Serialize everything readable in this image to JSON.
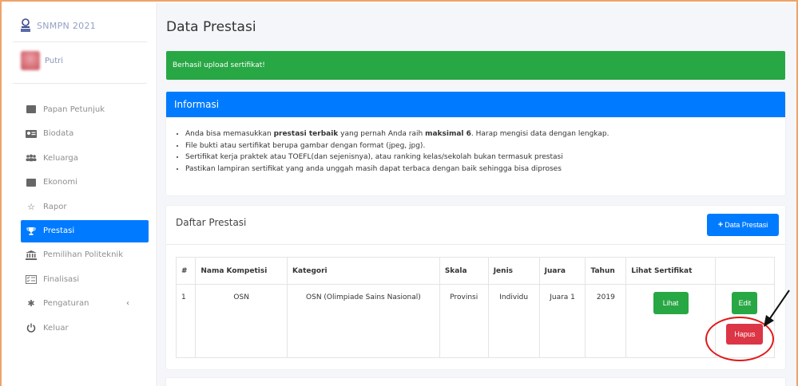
{
  "brand": {
    "title": "SNMPN 2021"
  },
  "user": {
    "name": "Putri"
  },
  "sidebar": {
    "items": [
      {
        "label": "Papan Petunjuk",
        "icon": "dashboard-icon"
      },
      {
        "label": "Biodata",
        "icon": "id-card-icon"
      },
      {
        "label": "Keluarga",
        "icon": "users-icon"
      },
      {
        "label": "Ekonomi",
        "icon": "wallet-icon"
      },
      {
        "label": "Rapor",
        "icon": "star-icon"
      },
      {
        "label": "Prestasi",
        "icon": "trophy-icon",
        "active": true
      },
      {
        "label": "Pemilihan Politeknik",
        "icon": "university-icon"
      },
      {
        "label": "Finalisasi",
        "icon": "checklist-icon"
      },
      {
        "label": "Pengaturan",
        "icon": "gear-icon",
        "chevron": "‹"
      },
      {
        "label": "Keluar",
        "icon": "power-icon"
      }
    ]
  },
  "page": {
    "title": "Data Prestasi"
  },
  "alert": {
    "message": "Berhasil upload sertifikat!"
  },
  "info": {
    "title": "Informasi",
    "items": {
      "i1_a": "Anda bisa memasukkan ",
      "i1_b": "prestasi terbaik",
      "i1_c": " yang pernah Anda raih ",
      "i1_d": "maksimal 6",
      "i1_e": ". Harap mengisi data dengan lengkap.",
      "i2": "File bukti atau sertifikat berupa gambar dengan format (jpeg, jpg).",
      "i3": "Sertifikat kerja praktek atau TOEFL(dan sejenisnya), atau ranking kelas/sekolah bukan termasuk prestasi",
      "i4": "Pastikan lampiran sertifikat yang anda unggah masih dapat terbaca dengan baik sehingga bisa diproses"
    }
  },
  "prestasi": {
    "title": "Daftar Prestasi",
    "add_label": "Data Prestasi",
    "columns": [
      "#",
      "Nama Kompetisi",
      "Kategori",
      "Skala",
      "Jenis",
      "Juara",
      "Tahun",
      "Lihat Sertifikat",
      ""
    ],
    "rows": [
      {
        "no": "1",
        "nama": "OSN",
        "kategori": "OSN (Olimpiade Sains Nasional)",
        "skala": "Provinsi",
        "jenis": "Individu",
        "juara": "Juara 1",
        "tahun": "2019",
        "lihat_label": "Lihat",
        "edit_label": "Edit",
        "hapus_label": "Hapus"
      }
    ]
  },
  "colors": {
    "primary": "#007bff",
    "success": "#28a745",
    "danger": "#dc3545",
    "annotation": "#e01818"
  }
}
